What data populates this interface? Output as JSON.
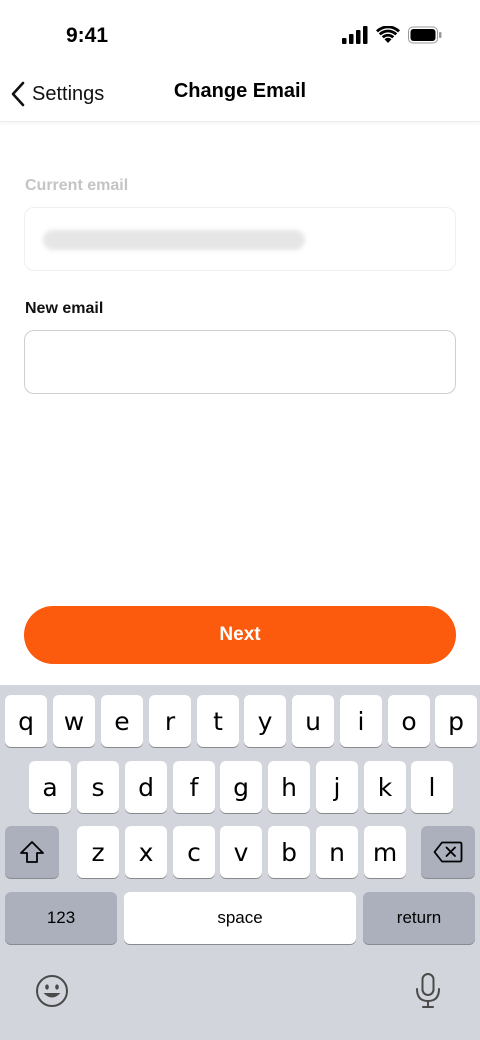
{
  "status_bar": {
    "time": "9:41",
    "icons": [
      "cellular-signal-icon",
      "wifi-icon",
      "battery-icon"
    ]
  },
  "nav": {
    "back_label": "Settings",
    "title": "Change Email"
  },
  "form": {
    "current_email_label": "Current email",
    "new_email_label": "New email",
    "new_email_value": ""
  },
  "actions": {
    "next_label": "Next"
  },
  "colors": {
    "accent": "#fc5a0c",
    "keyboard_bg": "#d3d5dc"
  },
  "keyboard": {
    "row1": [
      "q",
      "w",
      "e",
      "r",
      "t",
      "y",
      "u",
      "i",
      "o",
      "p"
    ],
    "row2": [
      "a",
      "s",
      "d",
      "f",
      "g",
      "h",
      "j",
      "k",
      "l"
    ],
    "row3": [
      "z",
      "x",
      "c",
      "v",
      "b",
      "n",
      "m"
    ],
    "numbers_label": "123",
    "space_label": "space",
    "return_label": "return"
  }
}
